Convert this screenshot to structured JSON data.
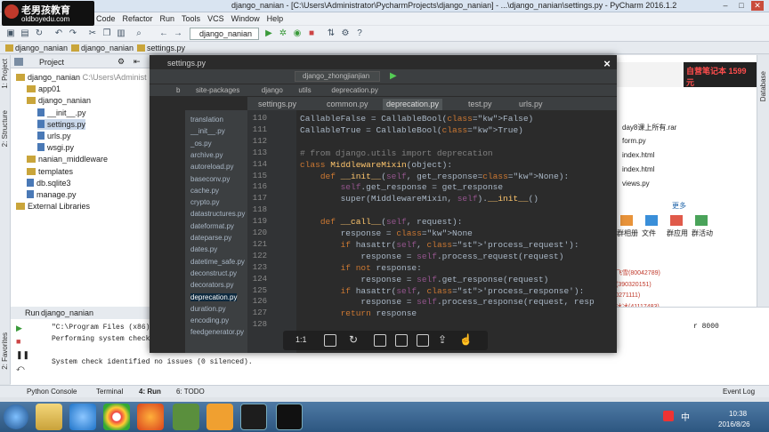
{
  "window": {
    "title": "django_nanian - [C:\\Users\\Administrator\\PycharmProjects\\django_nanian] - ...\\django_nanian\\settings.py - PyCharm 2016.1.2",
    "min": "–",
    "max": "□",
    "close": "✕"
  },
  "watermark": {
    "line1": "老男孩教育",
    "line2": "oldboyedu.com"
  },
  "menu": [
    "Code",
    "Refactor",
    "Run",
    "Tools",
    "VCS",
    "Window",
    "Help"
  ],
  "run_config": "django_nanian",
  "breadcrumbs": [
    "django_nanian",
    "django_nanian",
    "settings.py"
  ],
  "left_tabs": [
    "1: Project",
    "2: Structure",
    "2: Favorites"
  ],
  "project": {
    "header": "Project",
    "tree": [
      {
        "label": "django_nanian",
        "extra": "C:\\Users\\Administ",
        "type": "folder",
        "depth": 0
      },
      {
        "label": "app01",
        "type": "folder",
        "depth": 1
      },
      {
        "label": "django_nanian",
        "type": "folder",
        "depth": 1
      },
      {
        "label": "__init__.py",
        "type": "py",
        "depth": 2
      },
      {
        "label": "settings.py",
        "type": "py",
        "depth": 2
      },
      {
        "label": "urls.py",
        "type": "py",
        "depth": 2
      },
      {
        "label": "wsgi.py",
        "type": "py",
        "depth": 2
      },
      {
        "label": "nanian_middleware",
        "type": "folder",
        "depth": 1
      },
      {
        "label": "templates",
        "type": "folder",
        "depth": 1
      },
      {
        "label": "db.sqlite3",
        "type": "py",
        "depth": 1
      },
      {
        "label": "manage.py",
        "type": "py",
        "depth": 1
      },
      {
        "label": "External Libraries",
        "type": "folder",
        "depth": 0
      }
    ]
  },
  "run": {
    "label": "Run",
    "tab": "django_nanian",
    "lines": [
      "\"C:\\Program Files (x86)\\JetBrai",
      "Performing system checks...",
      "",
      "System check identified no issues (0 silenced)."
    ],
    "port_tail": "r 8000"
  },
  "bottom_tools": [
    "Python Console",
    "Terminal",
    "4: Run",
    "6: TODO",
    "Event Log"
  ],
  "viewer": {
    "title": "settings.py",
    "close": "×",
    "run_config": "django_zhongjianjian",
    "crumbs": [
      "b",
      "site-packages",
      "django",
      "utils",
      "deprecation.py"
    ],
    "tabs": [
      {
        "label": "settings.py",
        "active": false
      },
      {
        "label": "common.py",
        "active": false
      },
      {
        "label": "deprecation.py",
        "active": true
      },
      {
        "label": "test.py",
        "active": false
      },
      {
        "label": "urls.py",
        "active": false
      }
    ],
    "files": [
      "translation",
      "__init__.py",
      "_os.py",
      "archive.py",
      "autoreload.py",
      "baseconv.py",
      "cache.py",
      "crypto.py",
      "datastructures.py",
      "dateformat.py",
      "dateparse.py",
      "dates.py",
      "datetime_safe.py",
      "deconstruct.py",
      "decorators.py",
      "deprecation.py",
      "duration.py",
      "encoding.py",
      "feedgenerator.py"
    ],
    "selected_file": "deprecation.py",
    "line_numbers": [
      "110",
      "111",
      "112",
      "113",
      "114",
      "115",
      "116",
      "117",
      "118",
      "119",
      "120",
      "121",
      "122",
      "123",
      "124",
      "125",
      "126",
      "127",
      "128"
    ],
    "code": [
      "CallableFalse = CallableBool(False)",
      "CallableTrue = CallableBool(True)",
      "",
      "# from django.utils import deprecation",
      "class MiddlewareMixin(object):",
      "    def __init__(self, get_response=None):",
      "        self.get_response = get_response",
      "        super(MiddlewareMixin, self).__init__()",
      "",
      "    def __call__(self, request):",
      "        response = None",
      "        if hasattr(self, 'process_request'):",
      "            response = self.process_request(request)",
      "        if not response:",
      "            response = self.get_response(request)",
      "        if hasattr(self, 'process_response'):",
      "            response = self.process_response(request, resp",
      "        return response",
      ""
    ],
    "toolbar": [
      "1:1",
      "fit",
      "rotate",
      "save",
      "bookmark",
      "crop",
      "share",
      "like"
    ]
  },
  "right_panel": {
    "ad_text": "自营笔记本 1599元",
    "files": [
      "day8课上所有.rar",
      "form.py",
      "index.html",
      "index.html",
      "views.py"
    ],
    "more": "更多",
    "tools": [
      "群相册",
      "文件",
      "群应用",
      "群活动"
    ],
    "messages": [
      "老男孩教育飞雪(80042789)",
      "老男孩一吕(390320151)",
      "大吴老师(70271111)",
      "老男孩教育冰冰(41117483)",
      "老男孩教育丹丹(41117397)",
      "alex(317828332)",
      "(42452508)"
    ]
  },
  "right_tab": "Database",
  "tray": {
    "time": "10:38",
    "date": "2016/8/26",
    "ime": "中"
  }
}
